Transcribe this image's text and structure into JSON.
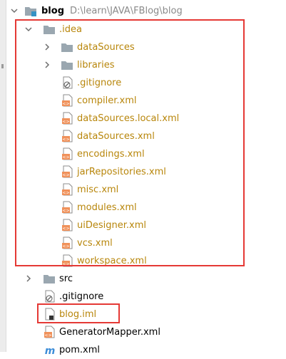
{
  "project": {
    "name": "blog",
    "path": "D:\\learn\\JAVA\\FBlog\\blog"
  },
  "idea": {
    "folder": ".idea",
    "subfolders": [
      "dataSources",
      "libraries"
    ],
    "files": [
      ".gitignore",
      "compiler.xml",
      "dataSources.local.xml",
      "dataSources.xml",
      "encodings.xml",
      "jarRepositories.xml",
      "misc.xml",
      "modules.xml",
      "uiDesigner.xml",
      "vcs.xml",
      "workspace.xml"
    ]
  },
  "root_items": {
    "src": "src",
    "gitignore": ".gitignore",
    "blog_iml": "blog.iml",
    "generator_mapper": "GeneratorMapper.xml",
    "pom": "pom.xml"
  },
  "colors": {
    "ignored_text": "#b8860b",
    "highlight": "#e53935",
    "xml_icon": "#f0915a",
    "folder_icon": "#9aa7b0"
  }
}
